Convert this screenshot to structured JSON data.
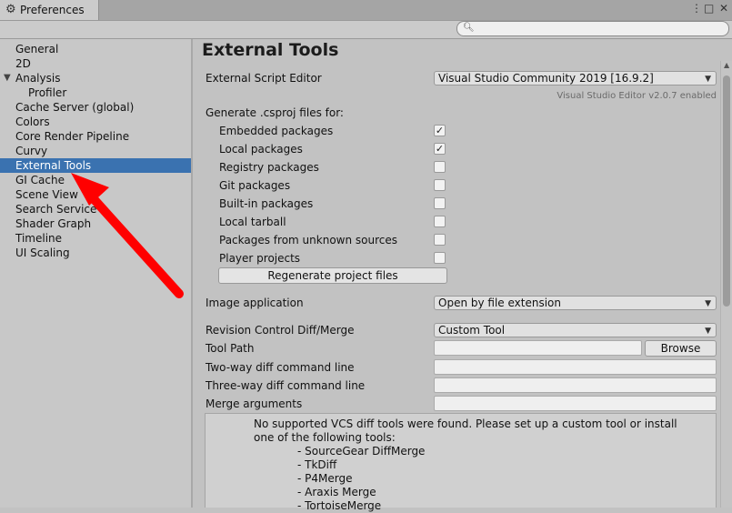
{
  "window": {
    "tab_title": "Preferences",
    "tab_icon": "gear-icon",
    "controls": [
      "⋮",
      "□",
      "✕"
    ]
  },
  "search": {
    "placeholder": "",
    "icon": "search-icon"
  },
  "sidebar": {
    "items": [
      {
        "label": "General"
      },
      {
        "label": "2D"
      },
      {
        "label": "Analysis"
      },
      {
        "label": "Profiler"
      },
      {
        "label": "Cache Server (global)"
      },
      {
        "label": "Colors"
      },
      {
        "label": "Core Render Pipeline"
      },
      {
        "label": "Curvy"
      },
      {
        "label": "External Tools"
      },
      {
        "label": "GI Cache"
      },
      {
        "label": "Scene View"
      },
      {
        "label": "Search Service"
      },
      {
        "label": "Shader Graph"
      },
      {
        "label": "Timeline"
      },
      {
        "label": "UI Scaling"
      }
    ],
    "selected": "External Tools",
    "selection_color": "#3a72b0"
  },
  "main": {
    "title": "External Tools",
    "script_editor": {
      "label": "External Script Editor",
      "value": "Visual Studio Community 2019 [16.9.2]",
      "hint": "Visual Studio Editor v2.0.7 enabled"
    },
    "csproj": {
      "label": "Generate .csproj files for:",
      "options": [
        {
          "label": "Embedded packages",
          "checked": true
        },
        {
          "label": "Local packages",
          "checked": true
        },
        {
          "label": "Registry packages",
          "checked": false
        },
        {
          "label": "Git packages",
          "checked": false
        },
        {
          "label": "Built-in packages",
          "checked": false
        },
        {
          "label": "Local tarball",
          "checked": false
        },
        {
          "label": "Packages from unknown sources",
          "checked": false
        },
        {
          "label": "Player projects",
          "checked": false
        }
      ],
      "regenerate_label": "Regenerate project files"
    },
    "image_application": {
      "label": "Image application",
      "value": "Open by file extension"
    },
    "revision_control": {
      "label": "Revision Control Diff/Merge",
      "value": "Custom Tool"
    },
    "tool_path": {
      "label": "Tool Path",
      "value": "",
      "browse_label": "Browse"
    },
    "two_way": {
      "label": "Two-way diff command line",
      "value": ""
    },
    "three_way": {
      "label": "Three-way diff command line",
      "value": ""
    },
    "merge_args": {
      "label": "Merge arguments",
      "value": ""
    },
    "help": {
      "message": "No supported VCS diff tools were found. Please set up a custom tool or install one of the following tools:",
      "tools": [
        "- SourceGear DiffMerge",
        "- TkDiff",
        "- P4Merge",
        "- Araxis Merge",
        "- TortoiseMerge"
      ]
    }
  },
  "annotation": {
    "type": "arrow",
    "color": "#ff0000"
  }
}
